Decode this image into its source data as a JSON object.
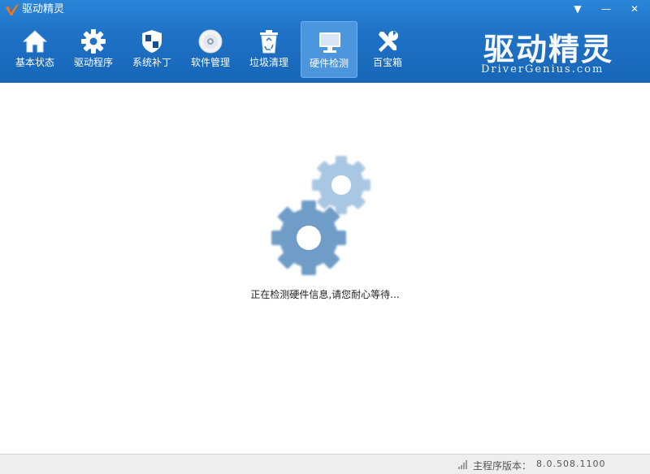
{
  "app": {
    "title": "驱动精灵"
  },
  "window_controls": {
    "menu": "▼",
    "minimize": "—",
    "close": "✕"
  },
  "tabs": [
    {
      "label": "基本状态",
      "icon": "home-icon"
    },
    {
      "label": "驱动程序",
      "icon": "gear-icon"
    },
    {
      "label": "系统补丁",
      "icon": "shield-icon"
    },
    {
      "label": "软件管理",
      "icon": "disc-icon"
    },
    {
      "label": "垃圾清理",
      "icon": "recycle-bin-icon"
    },
    {
      "label": "硬件检测",
      "icon": "monitor-icon",
      "active": true
    },
    {
      "label": "百宝箱",
      "icon": "tools-icon"
    }
  ],
  "brand": {
    "name_cn": "驱动精灵",
    "name_en": "DriverGenius.com"
  },
  "main": {
    "loading_text": "正在检测硬件信息,请您耐心等待..."
  },
  "statusbar": {
    "version_label": "主程序版本：",
    "version_value": "8.0.508.1100"
  },
  "colors": {
    "header": "#1f72c6",
    "active_tab": "#4c96de",
    "gear_dark": "#6f9cc8",
    "gear_light": "#a9c6e2"
  }
}
